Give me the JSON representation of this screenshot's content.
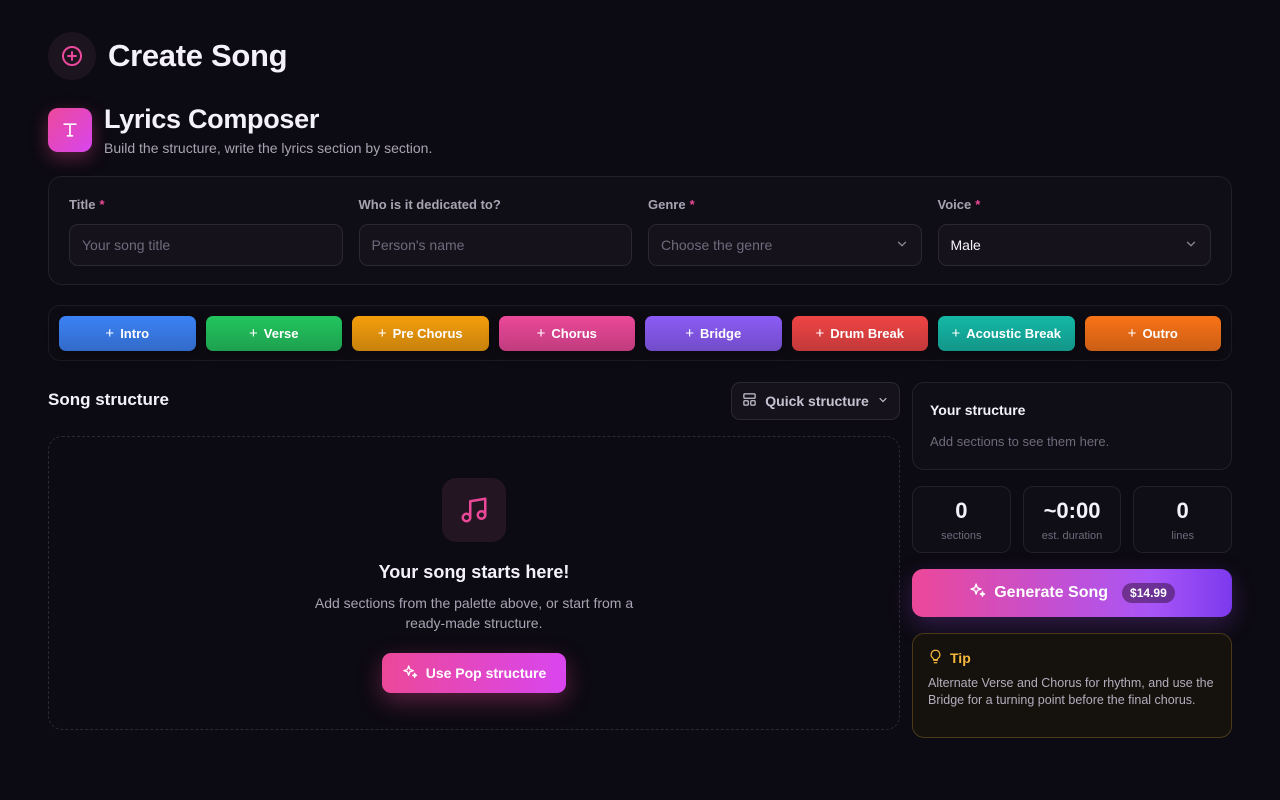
{
  "header": {
    "title": "Create Song",
    "icon": "plus-circle-icon"
  },
  "composer": {
    "title": "Lyrics Composer",
    "subtitle": "Build the structure, write the lyrics section by section.",
    "icon": "text-t-icon"
  },
  "form": {
    "title": {
      "label": "Title",
      "required": "*",
      "placeholder": "Your song title",
      "value": ""
    },
    "dedication": {
      "label": "Who is it dedicated to?",
      "placeholder": "Person's name",
      "value": ""
    },
    "genre": {
      "label": "Genre",
      "required": "*",
      "placeholder": "Choose the genre"
    },
    "voice": {
      "label": "Voice",
      "required": "*",
      "value": "Male"
    }
  },
  "palette": [
    {
      "label": "Intro",
      "color": "#3b82f6"
    },
    {
      "label": "Verse",
      "color": "#22c55e"
    },
    {
      "label": "Pre Chorus",
      "color": "#f59e0b"
    },
    {
      "label": "Chorus",
      "color": "#ec4899"
    },
    {
      "label": "Bridge",
      "color": "#8b5cf6"
    },
    {
      "label": "Drum Break",
      "color": "#ef4444"
    },
    {
      "label": "Acoustic Break",
      "color": "#14b8a6"
    },
    {
      "label": "Outro",
      "color": "#f97316"
    }
  ],
  "structure": {
    "title": "Song structure",
    "quick_label": "Quick structure",
    "empty_title": "Your song starts here!",
    "empty_desc": "Add sections from the palette above, or start from a ready-made structure.",
    "pop_button": "Use Pop structure"
  },
  "sidebar": {
    "your_structure_title": "Your structure",
    "your_structure_sub": "Add sections to see them here.",
    "stats": [
      {
        "value": "0",
        "label": "sections"
      },
      {
        "value": "~0:00",
        "label": "est. duration"
      },
      {
        "value": "0",
        "label": "lines"
      }
    ],
    "generate_label": "Generate Song",
    "price": "$14.99",
    "tip_title": "Tip",
    "tip_text": "Alternate Verse and Chorus for rhythm, and use the Bridge for a turning point before the final chorus."
  },
  "colors": {
    "accent": "#ec4899",
    "accent2": "#d946ef",
    "tip": "#f5b73b",
    "bg": "#0c0a12"
  }
}
